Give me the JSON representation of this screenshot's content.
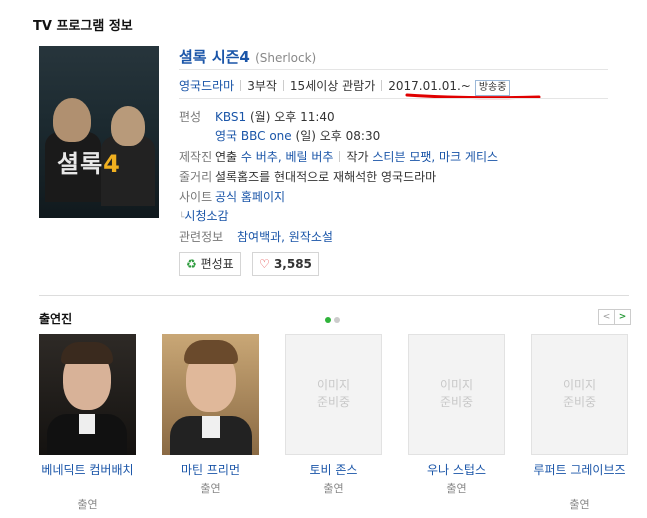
{
  "section_title": "TV 프로그램 정보",
  "program": {
    "poster_title": "셜록",
    "poster_title_num": "4",
    "title": "셜록 시즌4",
    "title_en": "(Sherlock)",
    "meta": [
      "영국드라마",
      "3부작",
      "15세이상 관람가",
      "2017.01.01.~"
    ],
    "badge": "방송중",
    "schedule_label": "편성",
    "schedule": [
      {
        "channel": "KBS1",
        "time": "(월) 오후 11:40"
      },
      {
        "channel": "영국 BBC one",
        "time": "(일) 오후 08:30"
      }
    ],
    "crew_label": "제작진",
    "crew_director_prefix": "연출",
    "crew_directors": "수 버추, 베릴 버추",
    "crew_writer_prefix": "작가",
    "crew_writers": "스티븐 모팻, 마크 게티스",
    "synopsis_label": "줄거리",
    "synopsis": "셜록홈즈를 현대적으로 재해석한 영국드라마",
    "site_label": "사이트",
    "site_link": "공식 홈페이지",
    "review_link": "시청소감",
    "related_label": "관련정보",
    "related_links": "참여백과, 원작소설",
    "schedule_button": "편성표",
    "like_count": "3,585"
  },
  "cast_section": {
    "title": "출연진",
    "no_image_text": [
      "이미지",
      "준비중"
    ],
    "members": [
      {
        "name": "베네딕트 컴버배치",
        "role": "출연"
      },
      {
        "name": "마틴 프리먼",
        "role": "출연"
      },
      {
        "name": "토비 존스",
        "role": "출연"
      },
      {
        "name": "우나 스텁스",
        "role": "출연"
      },
      {
        "name": "루퍼트 그레이브즈",
        "role": "출연"
      }
    ]
  },
  "colors": {
    "link": "#1a55a8",
    "badge": "#3a7bc8",
    "active_dot": "#2fb33a",
    "underline": "#e00000"
  }
}
